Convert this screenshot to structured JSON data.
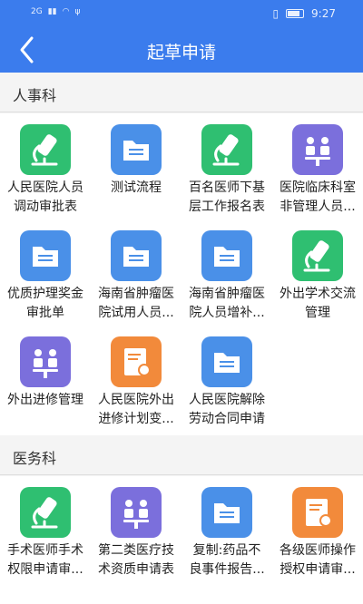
{
  "status": {
    "signal": "2G",
    "time": "9:27",
    "battery_icon": "battery-icon"
  },
  "navbar": {
    "title": "起草申请"
  },
  "sections": [
    {
      "name": "人事科",
      "items": [
        {
          "line1": "人民医院人员",
          "line2": "调动审批表",
          "icon": "microscope-icon",
          "color": "#2fbf71"
        },
        {
          "line1": "测试流程",
          "line2": "",
          "icon": "folder-icon",
          "color": "#4a90e8"
        },
        {
          "line1": "百名医师下基",
          "line2": "层工作报名表",
          "icon": "microscope-icon",
          "color": "#2fbf71"
        },
        {
          "line1": "医院临床科室",
          "line2": "非管理人员...",
          "icon": "meeting-icon",
          "color": "#7b6fdc"
        },
        {
          "line1": "优质护理奖金",
          "line2": "审批单",
          "icon": "folder-icon",
          "color": "#4a90e8"
        },
        {
          "line1": "海南省肿瘤医",
          "line2": "院试用人员...",
          "icon": "folder-icon",
          "color": "#4a90e8"
        },
        {
          "line1": "海南省肿瘤医",
          "line2": "院人员增补...",
          "icon": "folder-icon",
          "color": "#4a90e8"
        },
        {
          "line1": "外出学术交流",
          "line2": "管理",
          "icon": "microscope-icon",
          "color": "#2fbf71"
        },
        {
          "line1": "外出进修管理",
          "line2": "",
          "icon": "meeting-icon",
          "color": "#7b6fdc"
        },
        {
          "line1": "人民医院外出",
          "line2": "进修计划变...",
          "icon": "certificate-icon",
          "color": "#f28a3b"
        },
        {
          "line1": "人民医院解除",
          "line2": "劳动合同申请",
          "icon": "folder-icon",
          "color": "#4a90e8"
        }
      ]
    },
    {
      "name": "医务科",
      "items": [
        {
          "line1": "手术医师手术",
          "line2": "权限申请审...",
          "icon": "microscope-icon",
          "color": "#2fbf71"
        },
        {
          "line1": "第二类医疗技",
          "line2": "术资质申请表",
          "icon": "meeting-icon",
          "color": "#7b6fdc"
        },
        {
          "line1": "复制:药品不",
          "line2": "良事件报告...",
          "icon": "folder-icon",
          "color": "#4a90e8"
        },
        {
          "line1": "各级医师操作",
          "line2": "授权申请审...",
          "icon": "certificate-icon",
          "color": "#f28a3b"
        }
      ]
    }
  ]
}
